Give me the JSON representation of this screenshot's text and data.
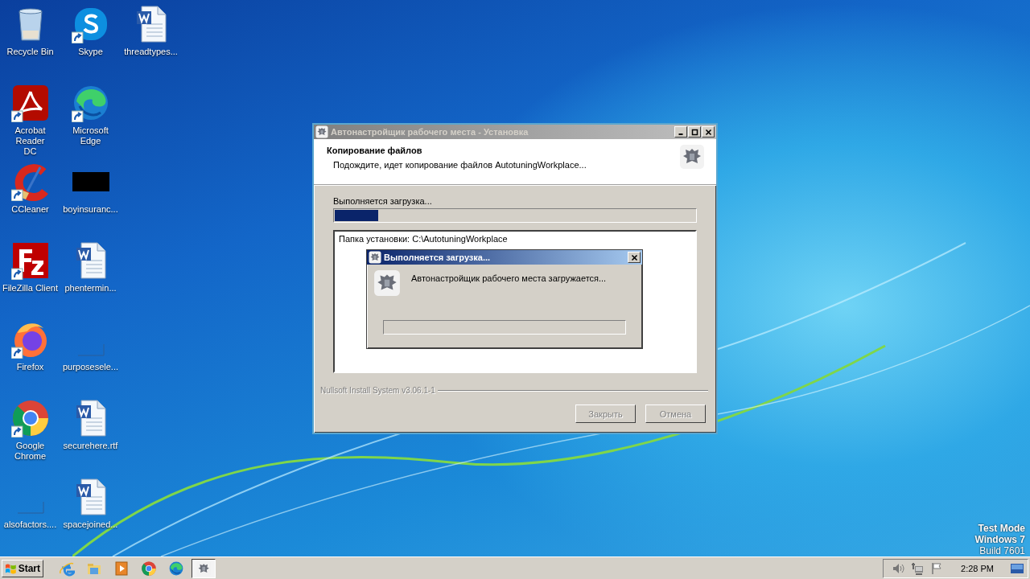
{
  "desktop": {
    "icons": [
      {
        "label": "Recycle Bin",
        "kind": "recycle",
        "shortcut": false
      },
      {
        "label": "Acrobat Reader DC",
        "kind": "acrobat",
        "shortcut": true
      },
      {
        "label": "CCleaner",
        "kind": "ccleaner",
        "shortcut": true
      },
      {
        "label": "FileZilla Client",
        "kind": "filezilla",
        "shortcut": true
      },
      {
        "label": "Firefox",
        "kind": "firefox",
        "shortcut": true
      },
      {
        "label": "Google Chrome",
        "kind": "chrome",
        "shortcut": true
      },
      {
        "label": "alsofactors....",
        "kind": "blank",
        "shortcut": false
      },
      {
        "label": "Skype",
        "kind": "skype",
        "shortcut": true
      },
      {
        "label": "Microsoft Edge",
        "kind": "edge",
        "shortcut": true
      },
      {
        "label": "boyinsuranc...",
        "kind": "dark",
        "shortcut": false
      },
      {
        "label": "phentermin...",
        "kind": "word",
        "shortcut": false
      },
      {
        "label": "purposesele...",
        "kind": "blank",
        "shortcut": false
      },
      {
        "label": "securehere.rtf",
        "kind": "word",
        "shortcut": false
      },
      {
        "label": "spacejoined...",
        "kind": "word",
        "shortcut": false
      },
      {
        "label": "threadtypes...",
        "kind": "word",
        "shortcut": false
      }
    ],
    "system_text": [
      "Test Mode",
      "Windows 7",
      "Build 7601"
    ]
  },
  "installer": {
    "title": "Автонастройщик рабочего места - Установка",
    "active": false,
    "header_title": "Копирование файлов",
    "header_subtitle": "Подождите, идет копирование файлов AutotuningWorkplace...",
    "status_text": "Выполняется загрузка...",
    "progress": {
      "level": 0.12
    },
    "log_lines": [
      "Папка установки: C:\\AutotuningWorkplace"
    ],
    "branding": "Nullsoft Install System v3.06.1-1",
    "buttons": [
      {
        "label": "Закрыть",
        "disabled": true
      },
      {
        "label": "Отмена",
        "disabled": true
      }
    ]
  },
  "dialog": {
    "title": "Выполняется загрузка...",
    "active": true,
    "message": "Автонастройщик рабочего места загружается...",
    "progress": {
      "level": 0
    }
  },
  "taskbar": {
    "start_label": "Start",
    "apps": [
      {
        "kind": "ie",
        "selected": false
      },
      {
        "kind": "explorer",
        "selected": false
      },
      {
        "kind": "media",
        "selected": false
      },
      {
        "kind": "chrome",
        "selected": false
      },
      {
        "kind": "edge",
        "selected": false
      },
      {
        "kind": "installer",
        "selected": true
      }
    ],
    "clock": "2:28 PM"
  }
}
